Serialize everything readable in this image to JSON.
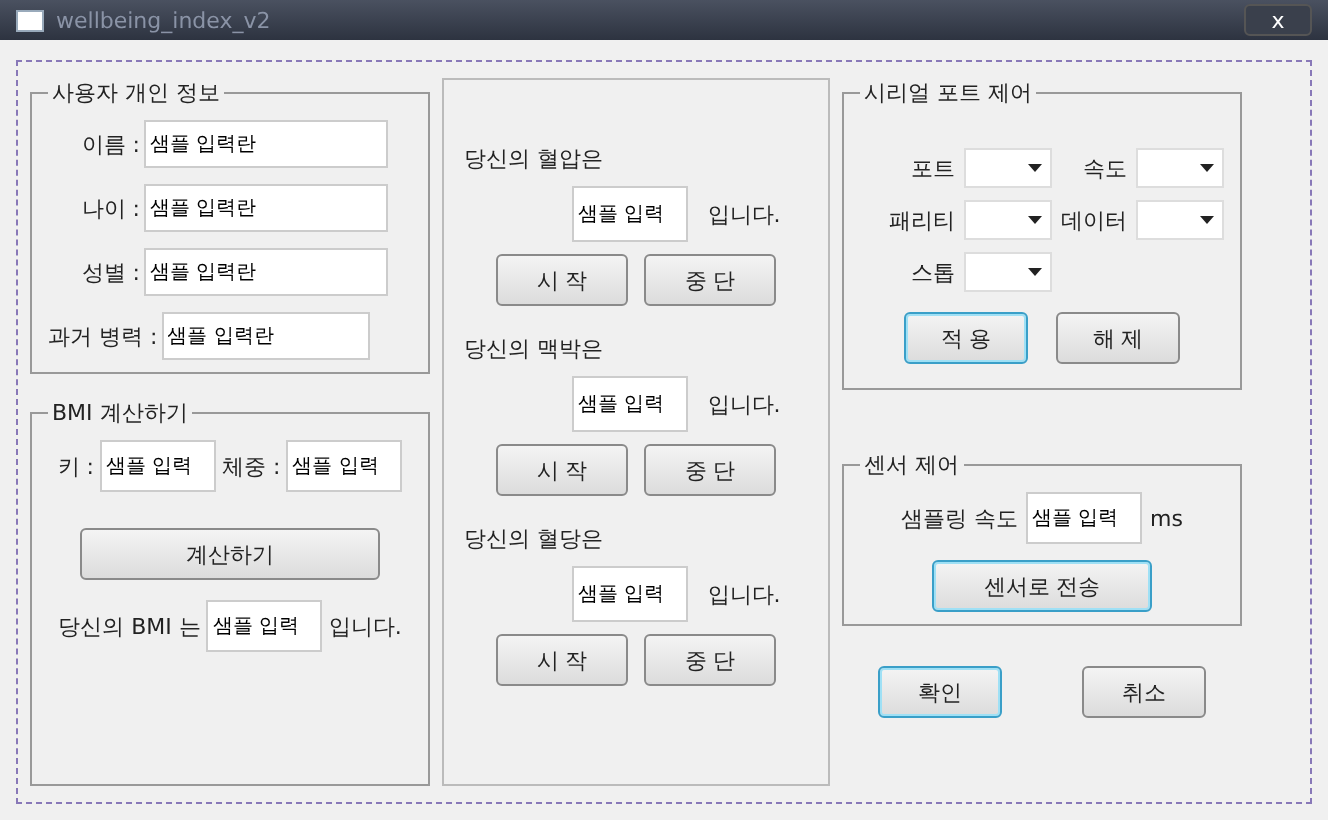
{
  "window": {
    "title": "wellbeing_index_v2",
    "close": "x"
  },
  "personal": {
    "title": "사용자 개인 정보",
    "fields": [
      {
        "label": "이름 :",
        "value": "샘플 입력란"
      },
      {
        "label": "나이 :",
        "value": "샘플 입력란"
      },
      {
        "label": "성별 :",
        "value": "샘플 입력란"
      },
      {
        "label": "과거 병력 :",
        "value": "샘플 입력란"
      }
    ]
  },
  "bmi": {
    "title": "BMI 계산하기",
    "inputs": [
      {
        "label": "키 :",
        "value": "샘플 입력"
      },
      {
        "label": "체중 :",
        "value": "샘플 입력"
      }
    ],
    "button": "계산하기",
    "result": {
      "prefix": "당신의 BMI 는",
      "value": "샘플 입력",
      "suffix": "입니다."
    }
  },
  "measurements": [
    {
      "prompt": "당신의 혈압은",
      "value": "샘플 입력",
      "suffix": "입니다.",
      "start": "시 작",
      "stop": "중 단"
    },
    {
      "prompt": "당신의 맥박은",
      "value": "샘플 입력",
      "suffix": "입니다.",
      "start": "시 작",
      "stop": "중 단"
    },
    {
      "prompt": "당신의 혈당은",
      "value": "샘플 입력",
      "suffix": "입니다.",
      "start": "시 작",
      "stop": "중 단"
    }
  ],
  "serial": {
    "title": "시리얼 포트 제어",
    "selects": [
      {
        "label": "포트"
      },
      {
        "label": "속도"
      },
      {
        "label": "패리티"
      },
      {
        "label": "데이터"
      },
      {
        "label": "스톱"
      }
    ],
    "buttons": [
      {
        "label": "적 용",
        "focused": true
      },
      {
        "label": "해 제",
        "focused": false
      }
    ]
  },
  "sensor": {
    "title": "센서 제어",
    "label": "샘플링 속도",
    "value": "샘플 입력",
    "unit": "ms",
    "button": {
      "label": "센서로 전송",
      "focused": true
    }
  },
  "dialog_buttons": [
    {
      "label": "확인",
      "focused": true
    },
    {
      "label": "취소",
      "focused": false
    }
  ]
}
